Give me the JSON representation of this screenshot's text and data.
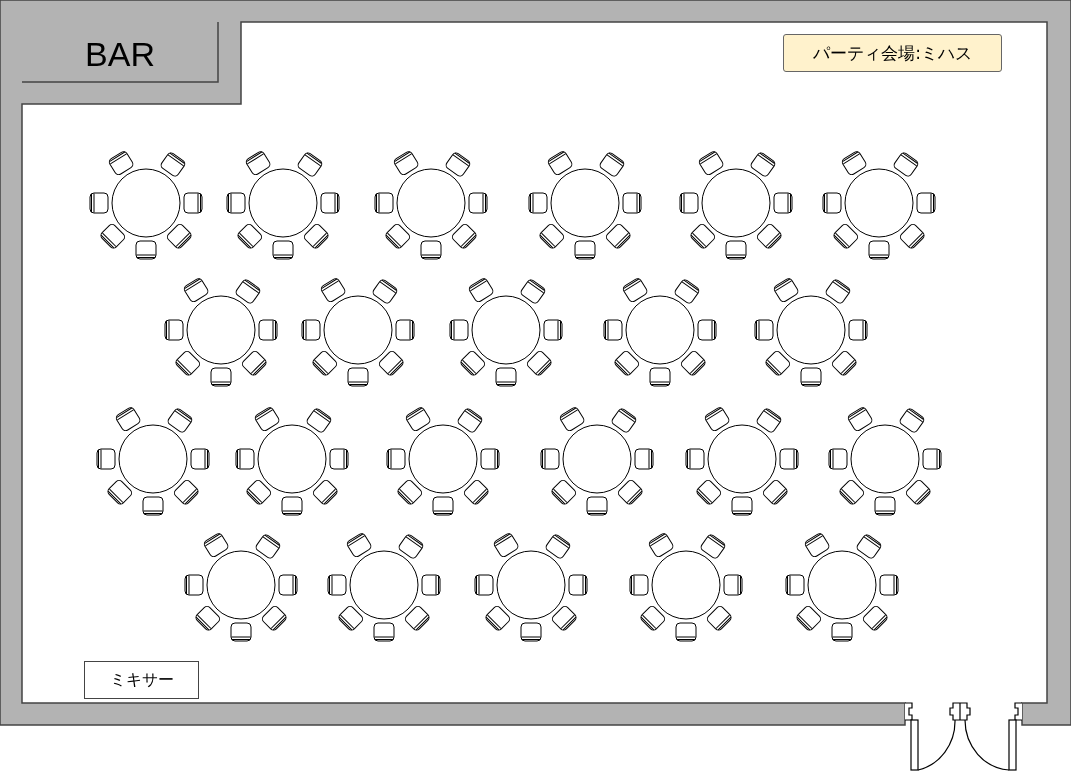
{
  "bar": {
    "label": "BAR"
  },
  "venue_label": "パーティ会場:ミハス",
  "mixer_label": "ミキサー",
  "table_rows": [
    {
      "tables": [
        {
          "kind": "round-table"
        },
        {
          "kind": "round-table"
        },
        {
          "kind": "round-table"
        },
        {
          "kind": "round-table"
        },
        {
          "kind": "round-table"
        },
        {
          "kind": "round-table"
        }
      ]
    },
    {
      "tables": [
        {
          "kind": "round-table"
        },
        {
          "kind": "round-table"
        },
        {
          "kind": "round-table"
        },
        {
          "kind": "round-table"
        },
        {
          "kind": "round-table"
        }
      ]
    },
    {
      "tables": [
        {
          "kind": "round-table"
        },
        {
          "kind": "round-table"
        },
        {
          "kind": "round-table"
        },
        {
          "kind": "round-table"
        },
        {
          "kind": "round-table"
        },
        {
          "kind": "round-table"
        }
      ]
    },
    {
      "tables": [
        {
          "kind": "round-table"
        },
        {
          "kind": "round-table"
        },
        {
          "kind": "round-table"
        },
        {
          "kind": "round-table"
        },
        {
          "kind": "round-table"
        }
      ]
    }
  ]
}
